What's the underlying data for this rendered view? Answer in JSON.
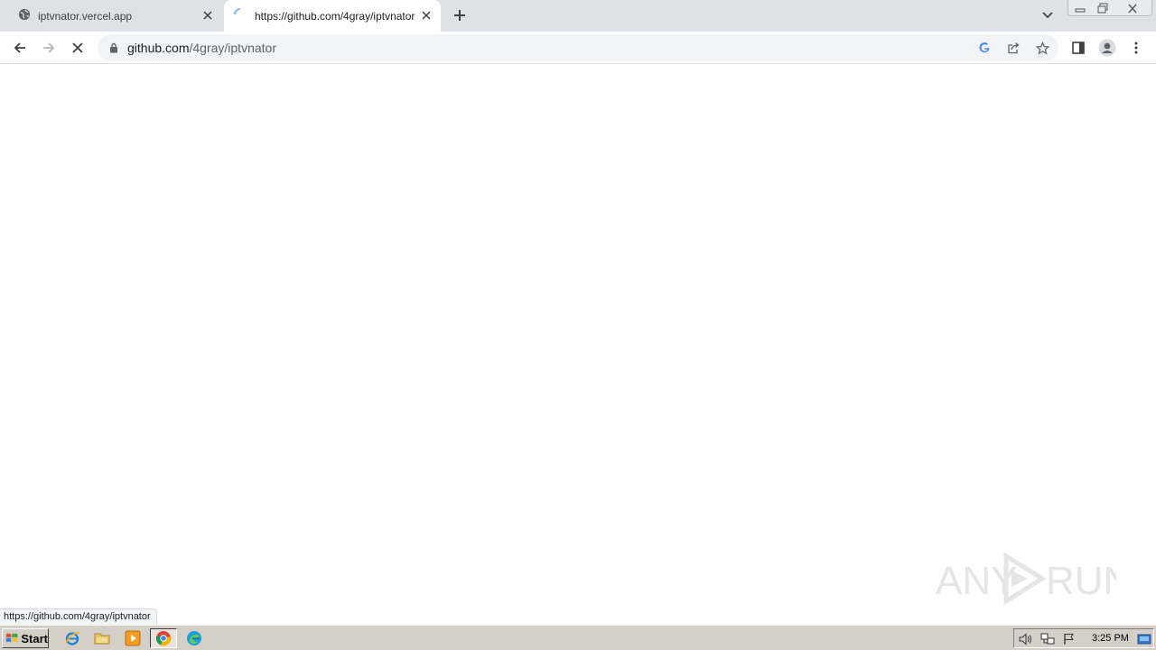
{
  "tabs": [
    {
      "title": "iptvnator.vercel.app",
      "icon": "globe-icon",
      "active": false
    },
    {
      "title": "https://github.com/4gray/iptvnator",
      "icon": "loading-spinner-icon",
      "active": true
    }
  ],
  "address_bar": {
    "host": "github.com",
    "path": "/4gray/iptvnator",
    "icon": "lock-icon"
  },
  "status_bar": {
    "link_url": "https://github.com/4gray/iptvnator"
  },
  "taskbar": {
    "start_label": "Start",
    "clock": "3:25 PM",
    "apps": [
      "ie-icon",
      "explorer-icon",
      "media-player-icon",
      "chrome-icon",
      "edge-icon"
    ]
  },
  "watermark": {
    "text_left": "ANY",
    "text_right": "RUN"
  },
  "colors": {
    "tabstrip": "#dee1e6",
    "omnibox": "#f1f3f4",
    "taskbar": "#d4d0c8",
    "google_blue": "#4285f4"
  }
}
